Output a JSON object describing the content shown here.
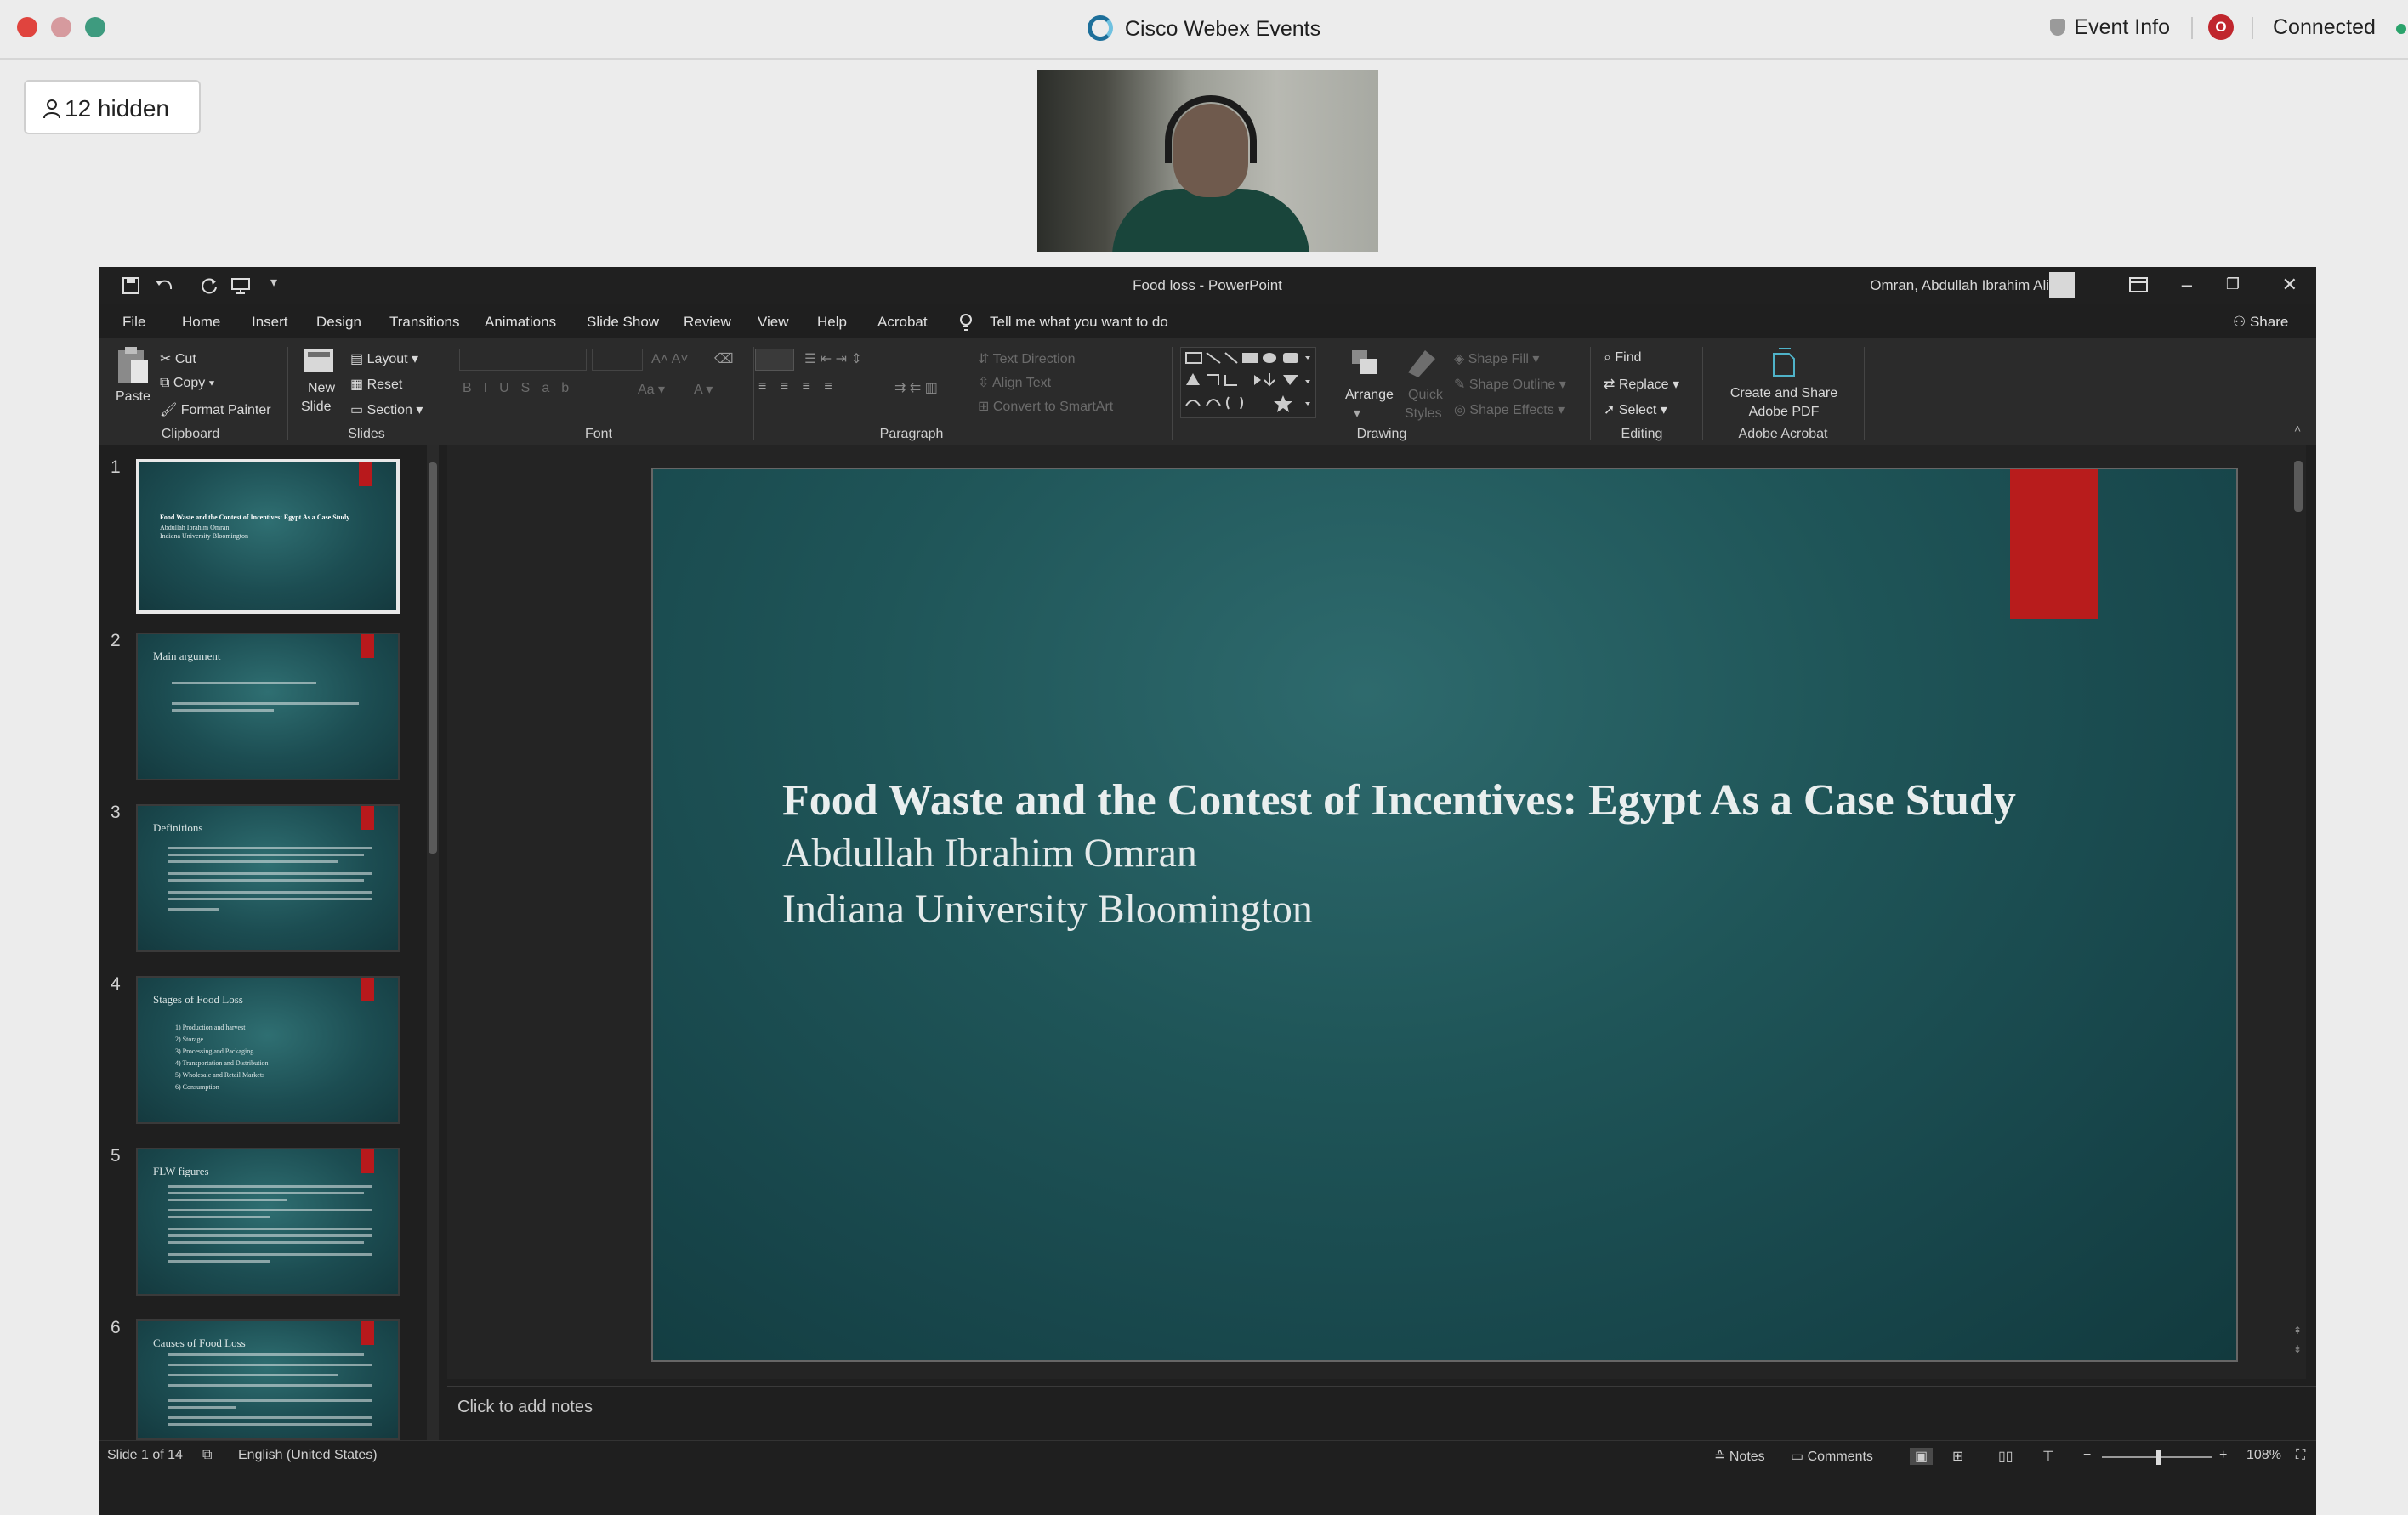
{
  "webex": {
    "app_title": "Cisco Webex Events",
    "event_info": "Event Info",
    "recording_badge": "O",
    "status": "Connected",
    "hidden_participants": "12 hidden",
    "traffic_colors": [
      "#e0443e",
      "#d69a9e",
      "#3e9b7f"
    ]
  },
  "ppt": {
    "doc_title": "Food loss  -  PowerPoint",
    "user": "Omran, Abdullah Ibrahim Ali",
    "menu": [
      "File",
      "Home",
      "Insert",
      "Design",
      "Transitions",
      "Animations",
      "Slide Show",
      "Review",
      "View",
      "Help",
      "Acrobat"
    ],
    "active_menu": "Home",
    "tell_me": "Tell me what you want to do",
    "share": "Share",
    "ribbon": {
      "clipboard": {
        "paste": "Paste",
        "cut": "Cut",
        "copy": "Copy",
        "format_painter": "Format Painter",
        "group": "Clipboard"
      },
      "slides": {
        "new_slide_1": "New",
        "new_slide_2": "Slide",
        "layout": "Layout",
        "reset": "Reset",
        "section": "Section",
        "group": "Slides"
      },
      "font": {
        "group": "Font"
      },
      "paragraph": {
        "text_direction": "Text Direction",
        "align_text": "Align Text",
        "smartart": "Convert to SmartArt",
        "group": "Paragraph"
      },
      "drawing": {
        "arrange": "Arrange",
        "quick_styles_1": "Quick",
        "quick_styles_2": "Styles",
        "shape_fill": "Shape Fill",
        "shape_outline": "Shape Outline",
        "shape_effects": "Shape Effects",
        "group": "Drawing"
      },
      "editing": {
        "find": "Find",
        "replace": "Replace",
        "select": "Select",
        "group": "Editing"
      },
      "acrobat": {
        "create_1": "Create and Share",
        "create_2": "Adobe PDF",
        "group": "Adobe Acrobat"
      }
    },
    "thumbnails": [
      {
        "num": "1",
        "title": "Food Waste and the Contest of Incentives: Egypt As a Case Study"
      },
      {
        "num": "2",
        "title": "Main argument"
      },
      {
        "num": "3",
        "title": "Definitions"
      },
      {
        "num": "4",
        "title": "Stages of Food Loss"
      },
      {
        "num": "5",
        "title": "FLW figures"
      },
      {
        "num": "6",
        "title": "Causes of Food Loss"
      }
    ],
    "thumb1_lines": [
      "Abdullah Ibrahim Omran",
      "Indiana University Bloomington"
    ],
    "thumb4_items": [
      "1) Production and harvest",
      "2) Storage",
      "3) Processing and Packaging",
      "4) Transportation and Distribution",
      "5) Wholesale and Retail Markets",
      "6) Consumption"
    ],
    "slide": {
      "title": "Food Waste and the Contest of Incentives: Egypt As a Case Study",
      "author": "Abdullah Ibrahim Omran",
      "affiliation": "Indiana University Bloomington",
      "accent_color": "#b81c1c"
    },
    "notes_placeholder": "Click to add notes",
    "status": {
      "slide_count": "Slide 1 of 14",
      "language": "English (United States)",
      "notes": "Notes",
      "comments": "Comments",
      "zoom": "108%"
    }
  }
}
